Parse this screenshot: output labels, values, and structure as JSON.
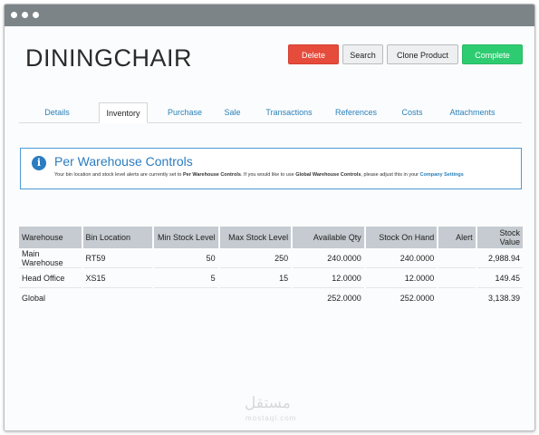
{
  "window": {
    "dots": [
      "dot",
      "dot",
      "dot"
    ]
  },
  "header": {
    "title": "DININGCHAIR",
    "buttons": {
      "delete": "Delete",
      "search": "Search",
      "clone": "Clone Product",
      "complete": "Complete"
    }
  },
  "tabs": [
    "Details",
    "Inventory",
    "Purchase",
    "Sale",
    "Transactions",
    "References",
    "Costs",
    "Attachments"
  ],
  "active_tab": "Inventory",
  "info": {
    "icon": "i",
    "title": "Per Warehouse Controls",
    "text_1": "Your bin location and stock level alerts are currently set to ",
    "bold_1": "Per Warehouse Controls",
    "text_2": ". If you would like to use ",
    "bold_2": "Global Warehouse Controls",
    "text_3": ", please adjust this in your ",
    "link": "Company Settings"
  },
  "table": {
    "headers": [
      "Warehouse",
      "Bin Location",
      "Min Stock Level",
      "Max Stock Level",
      "Available Qty",
      "Stock On Hand",
      "Alert",
      "Stock Value"
    ],
    "rows": [
      [
        "Main Warehouse",
        "RT59",
        "50",
        "250",
        "240.0000",
        "240.0000",
        "",
        "2,988.94"
      ],
      [
        "Head Office",
        "XS15",
        "5",
        "15",
        "12.0000",
        "12.0000",
        "",
        "149.45"
      ],
      [
        "Global",
        "",
        "",
        "",
        "252.0000",
        "252.0000",
        "",
        "3,138.39"
      ]
    ]
  },
  "watermark": {
    "arabic": "مستقل",
    "latin": "mostaql.com"
  }
}
